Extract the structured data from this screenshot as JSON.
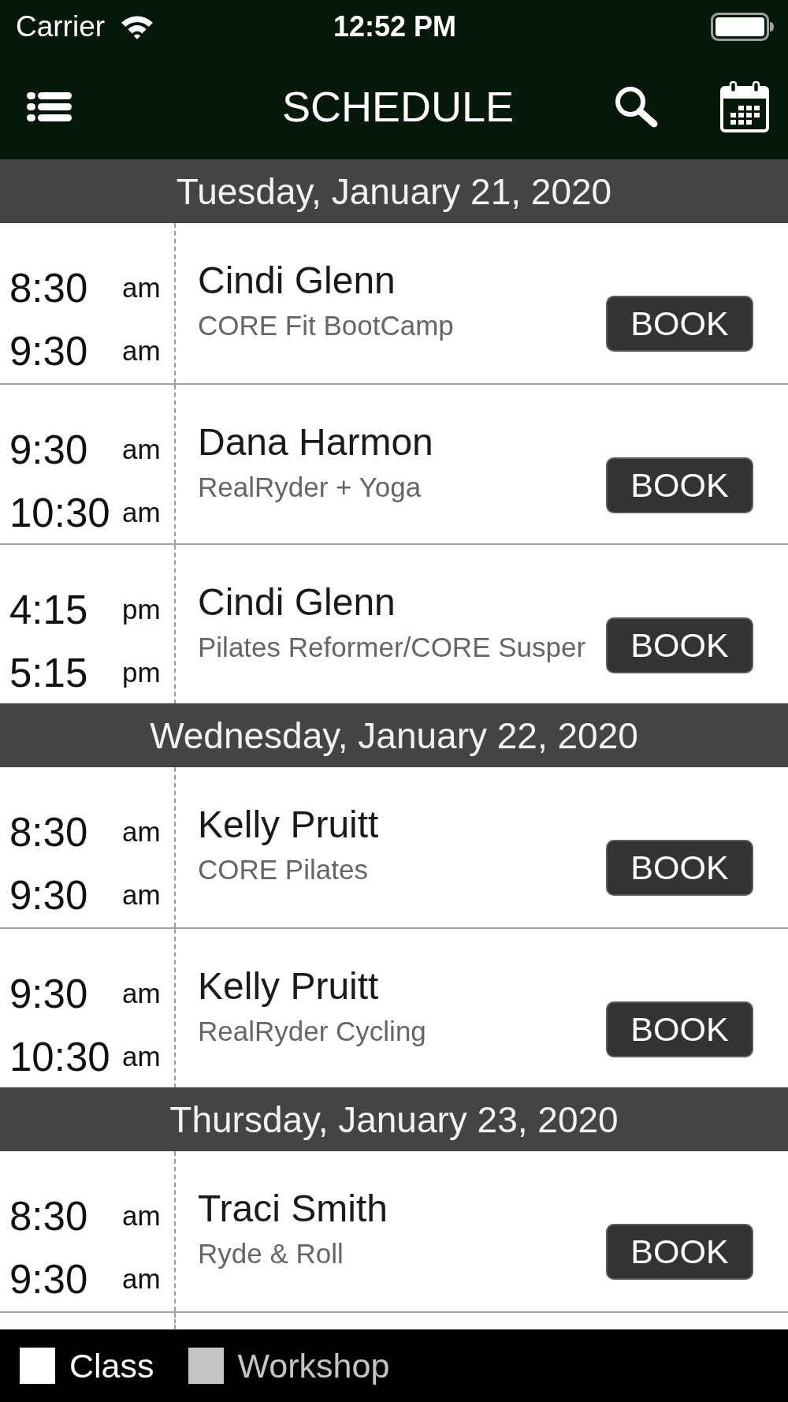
{
  "status_bar": {
    "carrier": "Carrier",
    "time": "12:52 PM"
  },
  "nav_bar": {
    "title": "SCHEDULE"
  },
  "days": [
    {
      "date": "Tuesday, January 21, 2020",
      "sessions": [
        {
          "start": "8:30",
          "start_period": "am",
          "end": "9:30",
          "end_period": "am",
          "instructor": "Cindi Glenn",
          "class_name": "CORE Fit BootCamp",
          "button": "BOOK"
        },
        {
          "start": "9:30",
          "start_period": "am",
          "end": "10:30",
          "end_period": "am",
          "instructor": "Dana Harmon",
          "class_name": "RealRyder + Yoga",
          "button": "BOOK"
        },
        {
          "start": "4:15",
          "start_period": "pm",
          "end": "5:15",
          "end_period": "pm",
          "instructor": "Cindi Glenn",
          "class_name": "Pilates Reformer/CORE Susper",
          "button": "BOOK"
        }
      ]
    },
    {
      "date": "Wednesday, January 22, 2020",
      "sessions": [
        {
          "start": "8:30",
          "start_period": "am",
          "end": "9:30",
          "end_period": "am",
          "instructor": "Kelly Pruitt",
          "class_name": "CORE Pilates",
          "button": "BOOK"
        },
        {
          "start": "9:30",
          "start_period": "am",
          "end": "10:30",
          "end_period": "am",
          "instructor": "Kelly Pruitt",
          "class_name": "RealRyder Cycling",
          "button": "BOOK"
        }
      ]
    },
    {
      "date": "Thursday, January 23, 2020",
      "sessions": [
        {
          "start": "8:30",
          "start_period": "am",
          "end": "9:30",
          "end_period": "am",
          "instructor": "Traci Smith",
          "class_name": "Ryde & Roll",
          "button": "BOOK"
        }
      ]
    }
  ],
  "legend": [
    {
      "label": "Class",
      "color": "#ffffff"
    },
    {
      "label": "Workshop",
      "color": "#c4c4c4"
    }
  ]
}
